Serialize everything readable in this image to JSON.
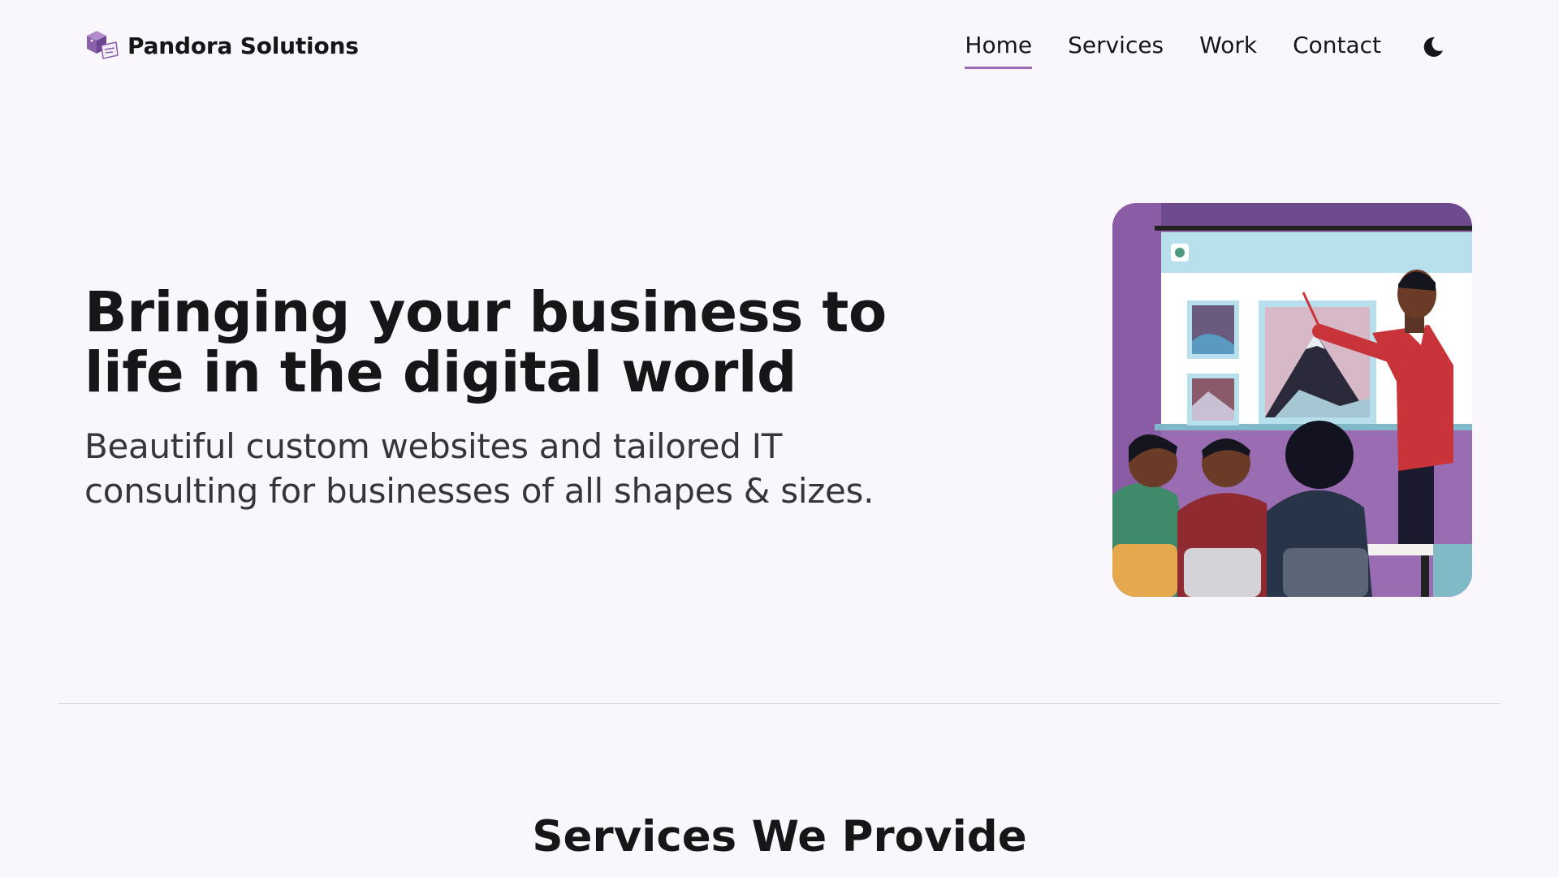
{
  "header": {
    "brand_name": "Pandora Solutions",
    "logo_icon": "box-icon",
    "nav": [
      {
        "label": "Home",
        "active": true
      },
      {
        "label": "Services",
        "active": false
      },
      {
        "label": "Work",
        "active": false
      },
      {
        "label": "Contact",
        "active": false
      }
    ],
    "theme_toggle_icon": "moon-icon"
  },
  "hero": {
    "title_line1": "Bringing your business to",
    "title_line2": "life in the digital world",
    "subtitle_line1": "Beautiful custom websites and tailored IT",
    "subtitle_line2": "consulting for businesses of all shapes & sizes.",
    "image": "presentation-illustration"
  },
  "services": {
    "title": "Services We Provide"
  },
  "colors": {
    "background": "#f9f7fb",
    "text": "#161618",
    "accent": "#9b6bb8",
    "divider": "#d7d5d9"
  }
}
